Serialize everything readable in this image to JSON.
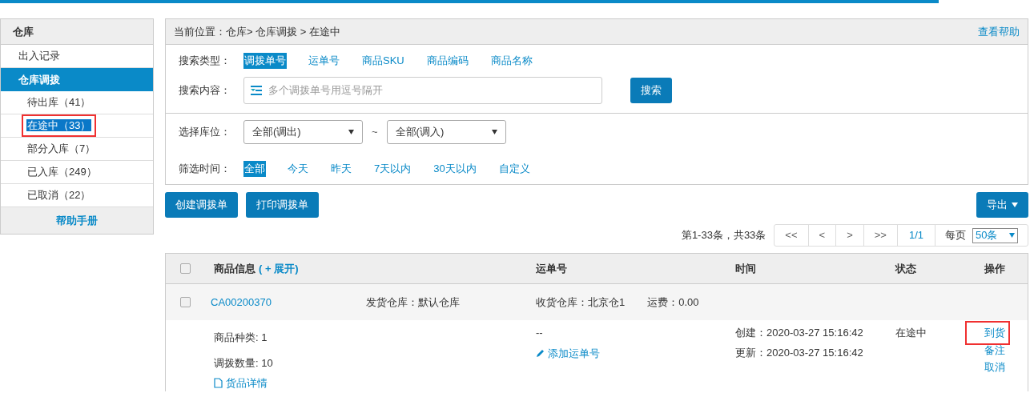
{
  "sidebar": {
    "title": "仓库",
    "items": [
      {
        "label": "出入记录",
        "active": false
      },
      {
        "label": "仓库调拨",
        "active": true,
        "children": [
          {
            "label": "待出库（41）",
            "selected": false,
            "annotated": false
          },
          {
            "label": "在途中（33）",
            "selected": true,
            "annotated": true
          },
          {
            "label": "部分入库（7）",
            "selected": false,
            "annotated": false
          },
          {
            "label": "已入库（249）",
            "selected": false,
            "annotated": false
          },
          {
            "label": "已取消（22）",
            "selected": false,
            "annotated": false
          }
        ]
      }
    ],
    "help_link": "帮助手册"
  },
  "breadcrumb": {
    "text": "当前位置：仓库> 仓库调拨 > 在途中",
    "help": "查看帮助"
  },
  "search": {
    "type_label": "搜索类型：",
    "types": [
      {
        "label": "调拨单号",
        "selected": true
      },
      {
        "label": "运单号",
        "selected": false
      },
      {
        "label": "商品SKU",
        "selected": false
      },
      {
        "label": "商品编码",
        "selected": false
      },
      {
        "label": "商品名称",
        "selected": false
      }
    ],
    "content_label": "搜索内容：",
    "placeholder": "多个调拨单号用逗号隔开",
    "button": "搜索"
  },
  "location": {
    "label": "选择库位：",
    "from": "全部(调出)",
    "separator": "~",
    "to": "全部(调入)"
  },
  "time_filter": {
    "label": "筛选时间：",
    "options": [
      {
        "label": "全部",
        "selected": true
      },
      {
        "label": "今天",
        "selected": false
      },
      {
        "label": "昨天",
        "selected": false
      },
      {
        "label": "7天以内",
        "selected": false
      },
      {
        "label": "30天以内",
        "selected": false
      },
      {
        "label": "自定义",
        "selected": false
      }
    ]
  },
  "actions": [
    "创建调拨单",
    "打印调拨单"
  ],
  "export": "导出",
  "pagination": {
    "summary": "第1-33条，共33条",
    "buttons": [
      "<<",
      "<",
      ">",
      ">>"
    ],
    "page": "1/1",
    "per_page_label": "每页",
    "per_page": "50条"
  },
  "table": {
    "all_checked": false,
    "columns": [
      "商品信息",
      "运单号",
      "时间",
      "状态",
      "操作"
    ],
    "expand_link": "( + 展开)",
    "rows": [
      {
        "checked": false,
        "order_no": "CA00200370",
        "from": "发货仓库：默认仓库",
        "to": "收货仓库：北京仓1",
        "freight": "运费：0.00",
        "kinds": "商品种类: 1",
        "quantity": "调拨数量: 10",
        "detail_link": "货品详情",
        "tracking": "--",
        "add_tracking": "添加运单号",
        "created": "创建：2020-03-27 15:16:42",
        "updated": "更新：2020-03-27 15:16:42",
        "status": "在途中",
        "actions": [
          {
            "label": "到货",
            "annotated": true
          },
          {
            "label": "备注",
            "annotated": false
          },
          {
            "label": "取消",
            "annotated": false
          }
        ]
      }
    ]
  }
}
